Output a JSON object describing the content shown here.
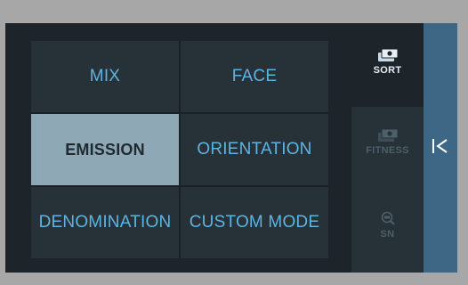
{
  "modes": [
    {
      "label": "MIX",
      "active": false
    },
    {
      "label": "FACE",
      "active": false
    },
    {
      "label": "EMISSION",
      "active": true
    },
    {
      "label": "ORIENTATION",
      "active": false
    },
    {
      "label": "DENOMINATION",
      "active": false
    },
    {
      "label": "CUSTOM MODE",
      "active": false
    }
  ],
  "side_menu": {
    "sort": {
      "label": "SORT",
      "icon": "banknotes-icon",
      "active": true
    },
    "fitness": {
      "label": "FITNESS",
      "icon": "banknotes-icon",
      "active": false
    },
    "sn": {
      "label": "SN",
      "icon": "serial-search-icon",
      "active": false
    }
  },
  "collapse": {
    "icon": "collapse-left-icon"
  },
  "colors": {
    "accent_text": "#5fb3e2",
    "active_tile": "#8fa8b5",
    "collapse_bar": "#3d6784"
  }
}
